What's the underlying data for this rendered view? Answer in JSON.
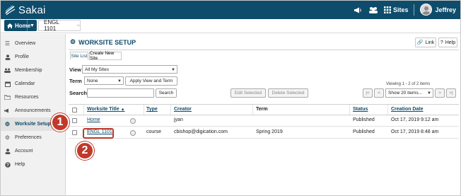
{
  "brand": {
    "name": "Sakai"
  },
  "topbar": {
    "sites_label": "Sites",
    "user_name": "Jeffrey"
  },
  "sitenav": {
    "home_label": "Home",
    "current_site": "ENGL 1101"
  },
  "leftnav": {
    "items": [
      {
        "label": "Overview",
        "icon": "list-icon"
      },
      {
        "label": "Profile",
        "icon": "person-icon"
      },
      {
        "label": "Membership",
        "icon": "group-icon"
      },
      {
        "label": "Calendar",
        "icon": "calendar-icon"
      },
      {
        "label": "Resources",
        "icon": "folder-icon"
      },
      {
        "label": "Announcements",
        "icon": "megaphone-icon"
      },
      {
        "label": "Worksite Setup",
        "icon": "gears-icon",
        "active": true
      },
      {
        "label": "Preferences",
        "icon": "gear-icon"
      },
      {
        "label": "Account",
        "icon": "person-icon"
      },
      {
        "label": "Help",
        "icon": "question-icon"
      }
    ]
  },
  "main": {
    "title": "WORKSITE SETUP",
    "link_label": "Link",
    "help_label": "Help",
    "tabs": [
      "Site List",
      "Create New Site"
    ],
    "view_label": "View",
    "view_value": "All My Sites",
    "term_label": "Term",
    "term_value": "None",
    "apply_label": "Apply View and Term",
    "search_label": "Search",
    "search_button": "Search",
    "search_value": "",
    "edit_selected": "Edit Selected",
    "delete_selected": "Delete Selected",
    "viewing_text": "Viewing 1 - 2 of 2 items",
    "page_size": "Show 20 items...",
    "pager": {
      "first": "|<",
      "prev": "<",
      "next": ">",
      "last": ">|"
    }
  },
  "table": {
    "headers": {
      "title": "Worksite Title",
      "type": "Type",
      "creator": "Creator",
      "term": "Term",
      "status": "Status",
      "created": "Creation Date"
    },
    "rows": [
      {
        "title": "Home",
        "type": "",
        "creator": "jyan",
        "term": "",
        "status": "Published",
        "created": "Oct 17, 2019 9:12 am"
      },
      {
        "title": "ENGL 1101",
        "type": "course",
        "creator": "cbishop@digication.com",
        "term": "Spring 2019",
        "status": "Published",
        "created": "Oct 17, 2019 8:48 am"
      }
    ]
  },
  "callouts": {
    "one": "1",
    "two": "2"
  },
  "colors": {
    "brand": "#0e4c6b",
    "callout": "#c0392b",
    "nav_bg": "#f1f1f1"
  }
}
